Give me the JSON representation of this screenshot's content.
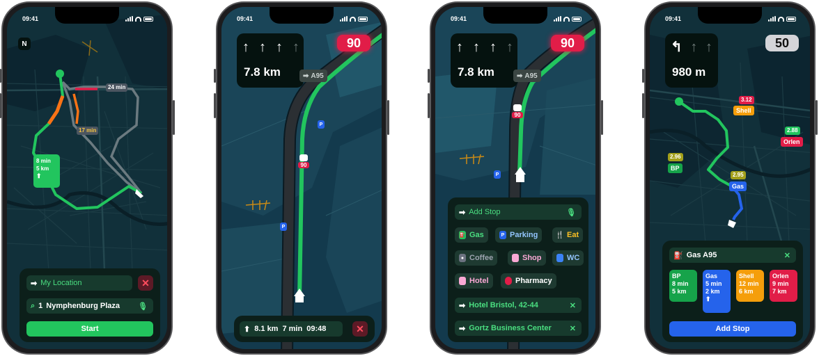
{
  "status": {
    "time": "09:41"
  },
  "screen1": {
    "compass": "N",
    "route_time_alt1": "24 min",
    "route_time_alt2": "17 min",
    "route_main_time": "8 min",
    "route_main_dist": "5 km",
    "from_placeholder": "My Location",
    "to_number": "1",
    "to_value": "Nymphenburg Plaza",
    "start_label": "Start"
  },
  "screen2": {
    "arrows": [
      "↑",
      "↑",
      "↑",
      "↑"
    ],
    "distance": "7.8 km",
    "road": "A95",
    "speed_limit": "90",
    "camera_speed": "90",
    "parking_label": "P",
    "trip_distance": "8.1 km",
    "trip_time": "7 min",
    "trip_eta": "09:48"
  },
  "screen3": {
    "arrows": [
      "↑",
      "↑",
      "↑",
      "↑"
    ],
    "distance": "7.8 km",
    "road": "A95",
    "speed_limit": "90",
    "camera_speed": "90",
    "parking_label": "P",
    "add_stop_placeholder": "Add Stop",
    "categories": [
      "Gas",
      "Parking",
      "Eat",
      "Coffee",
      "Shop",
      "WC",
      "Hotel",
      "Pharmacy"
    ],
    "stops": [
      "Hotel Bristol, 42-44",
      "Gortz Business Center"
    ]
  },
  "screen4": {
    "arrows": [
      "↰",
      "↑",
      "↑"
    ],
    "distance": "980 m",
    "speed_limit": "50",
    "map_prices": {
      "shell": "3.12",
      "orlen": "2.88",
      "bp": "2.96",
      "gas": "2.95"
    },
    "map_labels": {
      "shell": "Shell",
      "orlen": "Orlen",
      "bp": "BP",
      "gas": "Gas"
    },
    "search_value": "Gas A95",
    "stations": [
      {
        "name": "BP",
        "time": "8 min",
        "dist": "5 km"
      },
      {
        "name": "Gas",
        "time": "5 min",
        "dist": "2 km"
      },
      {
        "name": "Shell",
        "time": "12 min",
        "dist": "6 km"
      },
      {
        "name": "Orlen",
        "time": "9 min",
        "dist": "7 km"
      }
    ],
    "add_stop_label": "Add Stop"
  },
  "colors": {
    "accent_green": "#22c55e",
    "alert_red": "#e11d48",
    "blue": "#2563eb",
    "amber": "#f59e0b"
  }
}
